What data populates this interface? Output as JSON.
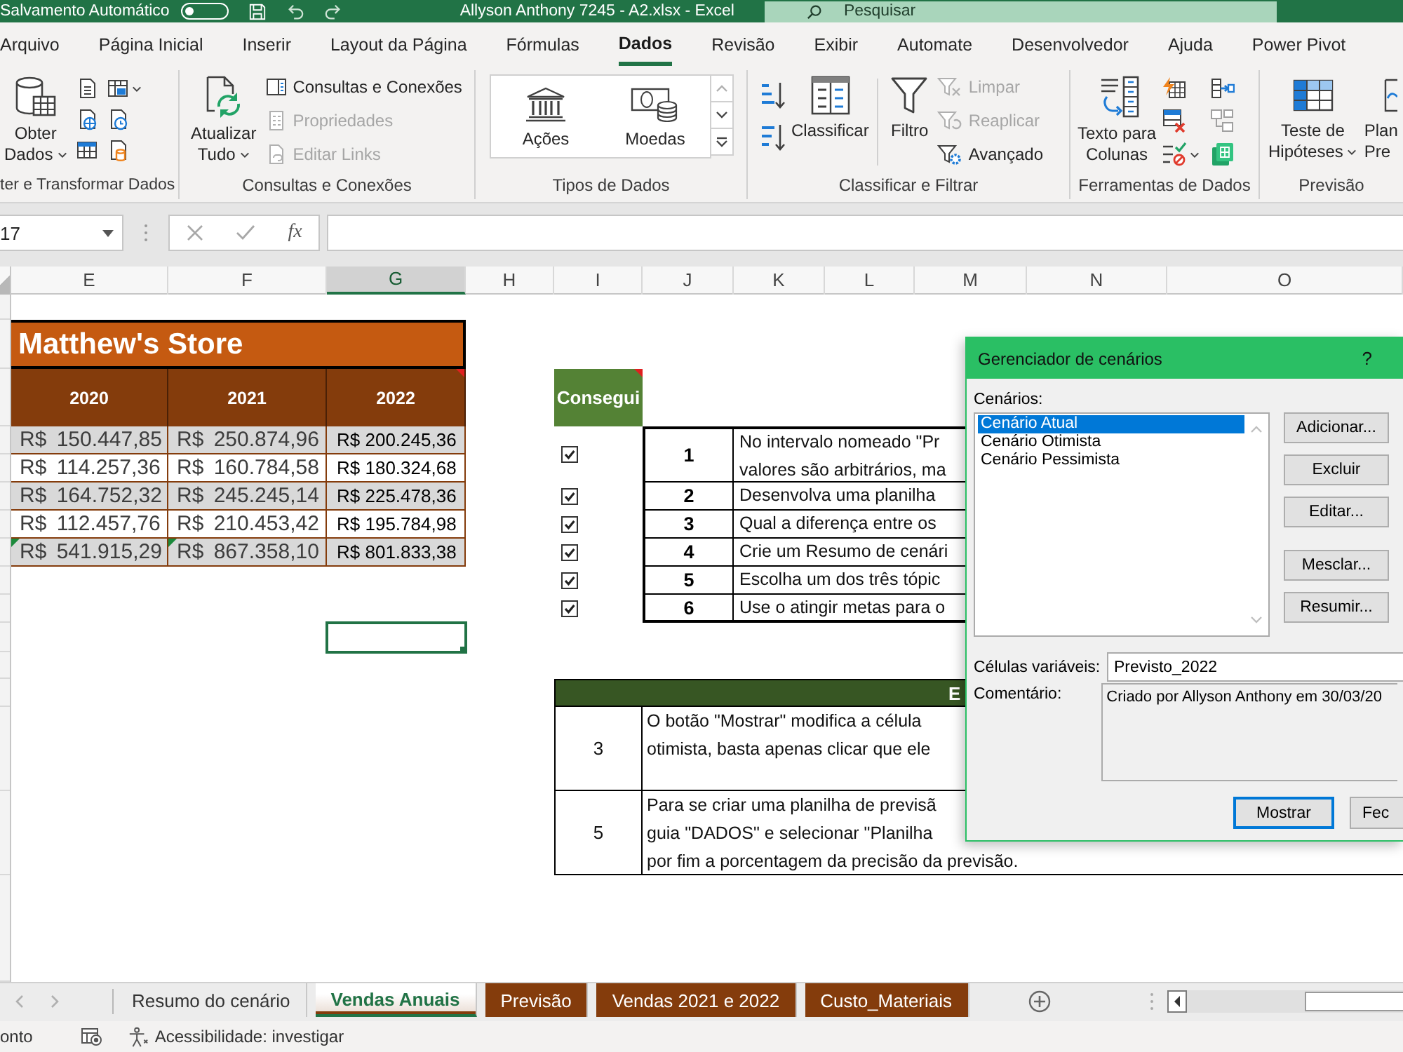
{
  "title_bar": {
    "autosave_label": "Salvamento Automático",
    "autosave_on": false,
    "title": "Allyson Anthony 7245 - A2.xlsx - Excel",
    "search_placeholder": "Pesquisar"
  },
  "ribbon_tabs": [
    {
      "label": "Arquivo",
      "selected": false
    },
    {
      "label": "Página Inicial",
      "selected": false
    },
    {
      "label": "Inserir",
      "selected": false
    },
    {
      "label": "Layout da Página",
      "selected": false
    },
    {
      "label": "Fórmulas",
      "selected": false
    },
    {
      "label": "Dados",
      "selected": true
    },
    {
      "label": "Revisão",
      "selected": false
    },
    {
      "label": "Exibir",
      "selected": false
    },
    {
      "label": "Automate",
      "selected": false
    },
    {
      "label": "Desenvolvedor",
      "selected": false
    },
    {
      "label": "Ajuda",
      "selected": false
    },
    {
      "label": "Power Pivot",
      "selected": false
    }
  ],
  "ribbon": {
    "get_transform": {
      "label": "ter e Transformar Dados",
      "get_data": {
        "lines": [
          "Obter",
          "Dados"
        ],
        "dropdown": true
      }
    },
    "queries": {
      "label": "Consultas e Conexões",
      "refresh_all": {
        "lines": [
          "Atualizar",
          "Tudo"
        ],
        "dropdown": true
      },
      "items": [
        {
          "label": "Consultas e Conexões",
          "disabled": false
        },
        {
          "label": "Propriedades",
          "disabled": true
        },
        {
          "label": "Editar Links",
          "disabled": true
        }
      ]
    },
    "data_types": {
      "label": "Tipos de Dados",
      "items": [
        {
          "label": "Ações"
        },
        {
          "label": "Moedas"
        }
      ]
    },
    "sort_filter": {
      "label": "Classificar e Filtrar",
      "sort": {
        "lines": [
          "Classificar"
        ]
      },
      "filter": {
        "lines": [
          "Filtro"
        ]
      },
      "items": [
        {
          "label": "Limpar",
          "disabled": true
        },
        {
          "label": "Reaplicar",
          "disabled": true
        },
        {
          "label": "Avançado",
          "disabled": false
        }
      ]
    },
    "data_tools": {
      "label": "Ferramentas de Dados",
      "text_to_columns": {
        "lines": [
          "Texto para",
          "Colunas"
        ]
      }
    },
    "forecast": {
      "label": "Previsão",
      "what_if": {
        "lines": [
          "Teste de",
          "Hipóteses"
        ],
        "dropdown": true
      },
      "forecast_sheet": {
        "lines": [
          "Plan",
          "Pre"
        ]
      }
    }
  },
  "formula_bar": {
    "name_box": "17",
    "function_button": "fx"
  },
  "columns": [
    {
      "label": "E",
      "selected": false
    },
    {
      "label": "F",
      "selected": false
    },
    {
      "label": "G",
      "selected": true
    },
    {
      "label": "H",
      "selected": false
    },
    {
      "label": "I",
      "selected": false
    },
    {
      "label": "J",
      "selected": false
    },
    {
      "label": "K",
      "selected": false
    },
    {
      "label": "L",
      "selected": false
    },
    {
      "label": "M",
      "selected": false
    },
    {
      "label": "N",
      "selected": false
    },
    {
      "label": "O",
      "selected": false
    }
  ],
  "store_table": {
    "title": "Matthew's Store",
    "years": [
      {
        "text": "2020"
      },
      {
        "text": "2021"
      },
      {
        "text": "2022",
        "comment_mark": true
      }
    ],
    "rows": [
      {
        "shaded": true,
        "cells": [
          {
            "text": "R$ 150.447,85"
          },
          {
            "text": "R$ 250.874,96"
          },
          {
            "text": "R$ 200.245,36"
          }
        ]
      },
      {
        "shaded": false,
        "cells": [
          {
            "text": "R$ 114.257,36"
          },
          {
            "text": "R$ 160.784,58"
          },
          {
            "text": "R$ 180.324,68"
          }
        ]
      },
      {
        "shaded": true,
        "cells": [
          {
            "text": "R$ 164.752,32"
          },
          {
            "text": "R$ 245.245,14"
          },
          {
            "text": "R$ 225.478,36"
          }
        ]
      },
      {
        "shaded": false,
        "cells": [
          {
            "text": "R$ 112.457,76"
          },
          {
            "text": "R$ 210.453,42"
          },
          {
            "text": "R$ 195.784,98"
          }
        ]
      },
      {
        "shaded": true,
        "cells": [
          {
            "text": "R$ 541.915,29",
            "error_mark": true
          },
          {
            "text": "R$ 867.358,10",
            "error_mark": true
          },
          {
            "text": "R$ 801.833,38"
          }
        ]
      }
    ]
  },
  "tasks": {
    "header": {
      "text": "Consegui",
      "comment_mark": true
    },
    "items": [
      {
        "checked": true,
        "number": "1",
        "lines": [
          "No intervalo nomeado \"Pr",
          "valores são arbitrários, ma"
        ]
      },
      {
        "checked": true,
        "number": "2",
        "lines": [
          "Desenvolva uma planilha"
        ]
      },
      {
        "checked": true,
        "number": "3",
        "lines": [
          "Qual a diferença entre os"
        ]
      },
      {
        "checked": true,
        "number": "4",
        "lines": [
          "Crie um Resumo de cenári"
        ]
      },
      {
        "checked": true,
        "number": "5",
        "lines": [
          "Escolha um dos três tópic"
        ]
      },
      {
        "checked": true,
        "number": "6",
        "lines": [
          "Use o atingir metas para o"
        ]
      }
    ]
  },
  "explanations": {
    "header": "E",
    "rows": [
      {
        "number": "3",
        "lines": [
          "O botão \"Mostrar\" modifica a célula",
          "otimista, basta apenas clicar que ele"
        ]
      },
      {
        "number": "5",
        "lines": [
          "Para se criar uma planilha de previsã",
          "guia \"DADOS\" e selecionar \"Planilha",
          "por fim a porcentagem da precisão da previsão."
        ]
      }
    ]
  },
  "dialog": {
    "title": "Gerenciador de cenários",
    "help": "?",
    "scenarios_label": "Cenários:",
    "scenarios": [
      {
        "label": "Cenário Atual",
        "selected": true
      },
      {
        "label": "Cenário Otimista",
        "selected": false
      },
      {
        "label": "Cenário Pessimista",
        "selected": false
      }
    ],
    "actions": [
      "Adicionar...",
      "Excluir",
      "Editar...",
      "Mesclar...",
      "Resumir..."
    ],
    "changing_cells_label": "Células variáveis:",
    "changing_cells": "Previsto_2022",
    "comment_label": "Comentário:",
    "comment": "Criado por Allyson Anthony em 30/03/20",
    "buttons": [
      {
        "label": "Mostrar",
        "default": true
      },
      {
        "label": "Fec",
        "default": false
      }
    ]
  },
  "sheet_tabs": [
    {
      "label": "Resumo do cenário",
      "selected": false
    },
    {
      "label": "Vendas Anuais",
      "selected": true,
      "color": "#843c0c"
    },
    {
      "label": "Previsão",
      "selected": false,
      "color": "#843c0c"
    },
    {
      "label": "Vendas 2021 e 2022",
      "selected": false,
      "color": "#843c0c"
    },
    {
      "label": "Custo_Materiais",
      "selected": false,
      "color": "#843c0c"
    }
  ],
  "status_bar": {
    "mode": "onto",
    "accessibility": "Acessibilidade: investigar"
  }
}
